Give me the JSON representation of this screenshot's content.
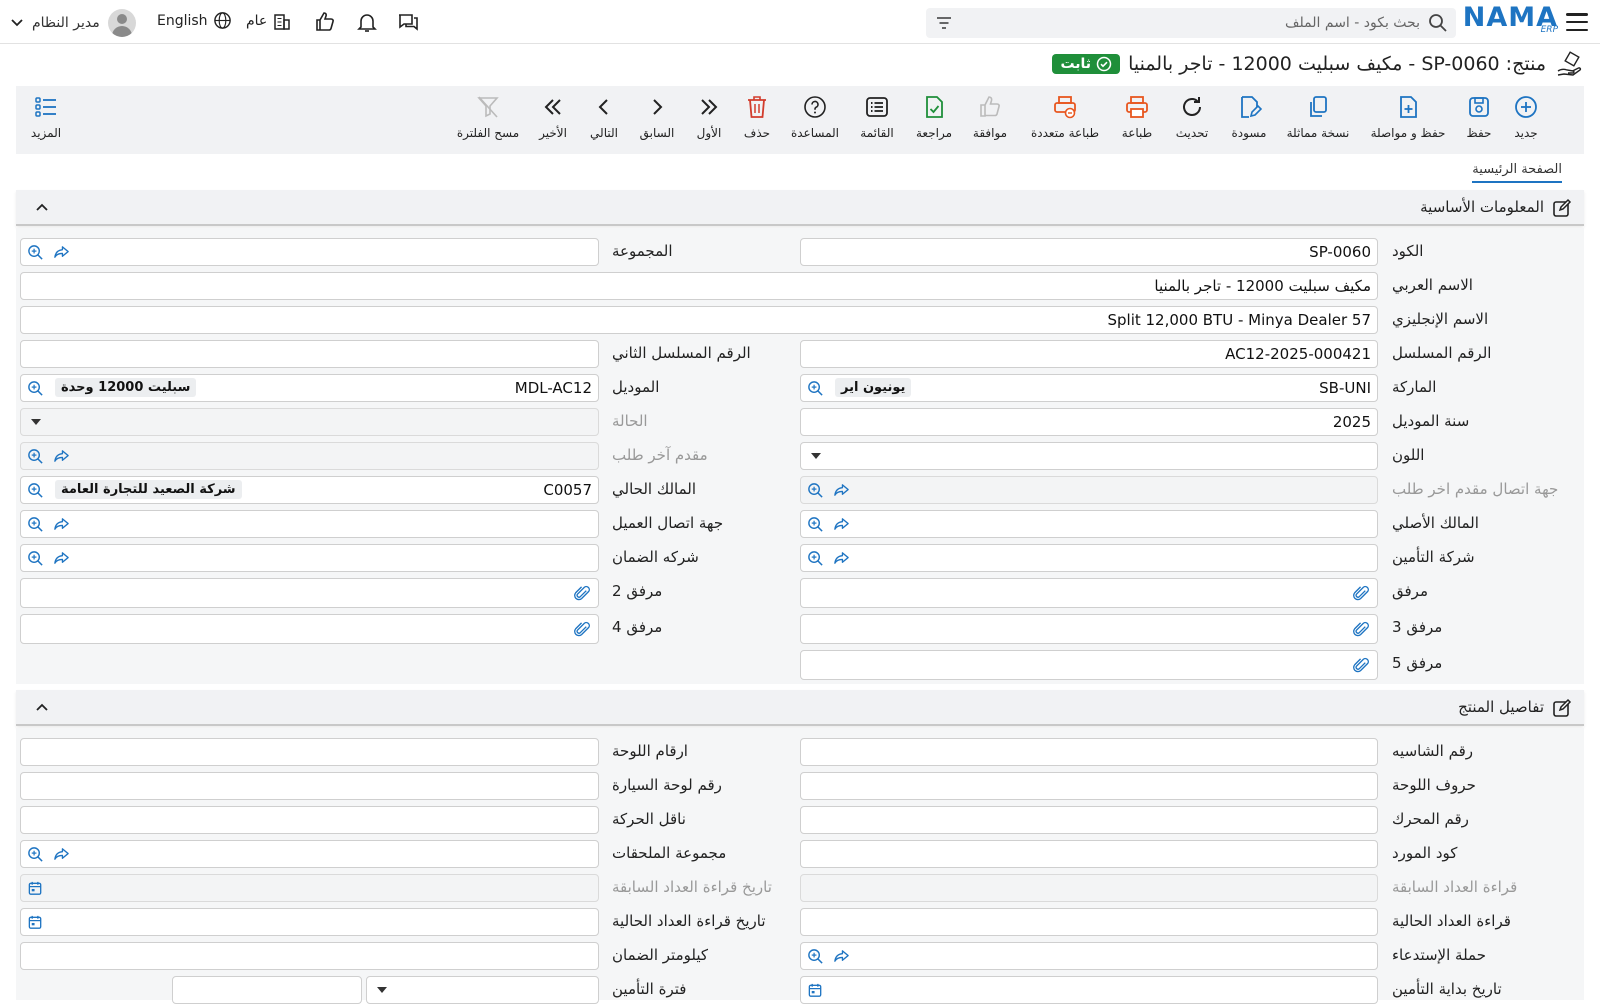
{
  "topbar": {
    "logo_text": "NAMA",
    "logo_sub": "ERP",
    "search_placeholder": "بحث بكود - اسم الملف",
    "user_name": "مدير النظام",
    "language": "English",
    "scope": "عام"
  },
  "title": {
    "text": "منتج: SP-0060 - مكيف سبليت 12000 - تاجر بالمنيا",
    "status": "ثابت"
  },
  "toolbar": {
    "new": "جديد",
    "save": "حفظ",
    "save_continue": "حفظ و مواصلة",
    "duplicate": "نسخة مماثلة",
    "draft": "مسودة",
    "refresh": "تحديث",
    "print": "طباعة",
    "multi_print": "طباعة متعددة",
    "approve": "موافقة",
    "review": "مراجعة",
    "list": "القائمة",
    "help": "المساعدة",
    "delete": "حذف",
    "first": "الأول",
    "previous": "السابق",
    "next": "التالي",
    "last": "الأخير",
    "clear_filter": "مسح الفلترة",
    "more": "المزيد"
  },
  "tabs": {
    "main": "الصفحة الرئيسية"
  },
  "sections": {
    "basic": "المعلومات الأساسية",
    "details": "تفاصيل المنتج"
  },
  "basic": {
    "code_label": "الكود",
    "code_value": "SP-0060",
    "group_label": "المجموعة",
    "arabic_name_label": "الاسم العربي",
    "arabic_name_value": "مكيف سبليت 12000 - تاجر بالمنيا",
    "english_name_label": "الاسم الإنجليزي",
    "english_name_value": "Split 12,000 BTU - Minya Dealer 57",
    "serial_label": "الرقم المسلسل",
    "serial_value": "AC12-2025-000421",
    "serial2_label": "الرقم المسلسل الثاني",
    "brand_label": "الماركة",
    "brand_code": "SB-UNI",
    "brand_name": "يونيون اير",
    "model_label": "الموديل",
    "model_code": "MDL-AC12",
    "model_name": "سبليت 12000 وحدة",
    "model_year_label": "سنة الموديل",
    "model_year_value": "2025",
    "status_label": "الحالة",
    "color_label": "اللون",
    "last_requester_label": "مقدم آخر طلب",
    "last_requester_contact_label": "جهة اتصال مقدم اخر طلب",
    "current_owner_label": "المالك الحالي",
    "current_owner_code": "C0057",
    "current_owner_name": "شركة الصعيد للتجارة العامة",
    "original_owner_label": "المالك الأصلي",
    "customer_contact_label": "جهة اتصال العميل",
    "insurance_company_label": "شركة التأمين",
    "warranty_company_label": "شركه الضمان",
    "attachment_label": "مرفق",
    "attachment2_label": "مرفق 2",
    "attachment3_label": "مرفق 3",
    "attachment4_label": "مرفق 4",
    "attachment5_label": "مرفق 5"
  },
  "details": {
    "chassis_label": "رقم الشاسيه",
    "plate_numbers_label": "ارقام اللوحة",
    "plate_letters_label": "حروف اللوحة",
    "car_plate_label": "رقم لوحة السيارة",
    "engine_label": "رقم المحرك",
    "gearbox_label": "ناقل الحركة",
    "supplier_code_label": "كود المورد",
    "accessories_group_label": "مجموعة الملحقات",
    "prev_meter_label": "قراءة العداد السابقة",
    "prev_meter_date_label": "تاريخ قراءة العداد السابقة",
    "curr_meter_label": "قراءة العداد الحالية",
    "curr_meter_date_label": "تاريخ قراءة العداد الحالية",
    "recall_campaign_label": "حملة الإستدعاء",
    "warranty_km_label": "كيلومتر الضمان",
    "insurance_start_label": "تاريخ بداية التأمين",
    "insurance_period_label": "فترة التأمين"
  }
}
